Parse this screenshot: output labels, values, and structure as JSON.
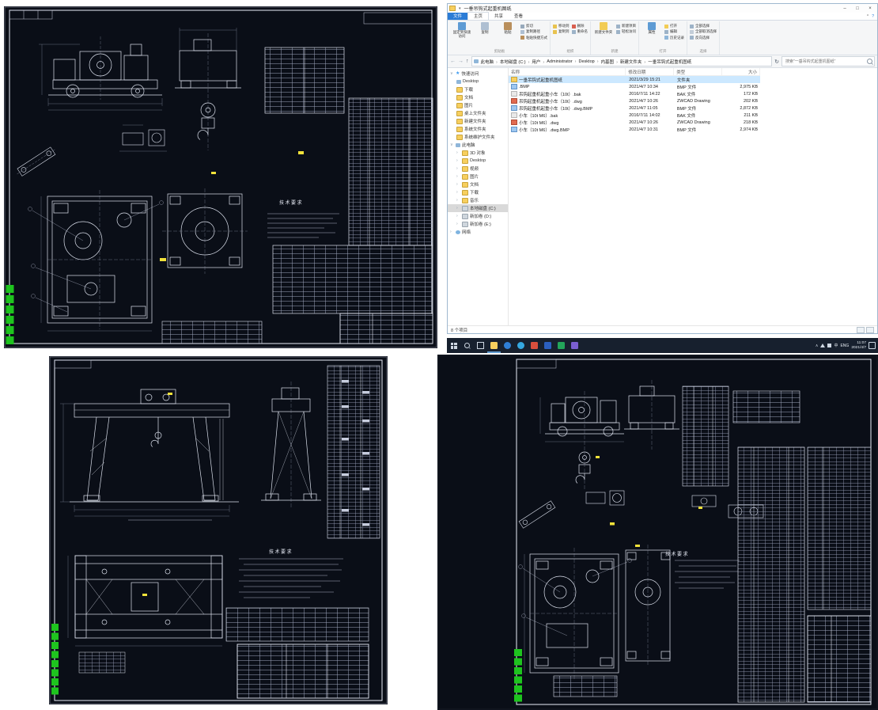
{
  "explorer": {
    "title": "一垂吊钩式起重机图纸",
    "tabs": {
      "file": "文件",
      "home": "主页",
      "share": "共享",
      "view": "查看"
    },
    "ribbon": {
      "pin_to_quick_access": "固定到快速访问",
      "copy": "复制",
      "paste": "粘贴",
      "cut": "剪切",
      "copy_path": "复制路径",
      "paste_shortcut": "粘贴快捷方式",
      "move_to": "移动到",
      "copy_to": "复制到",
      "delete": "删除",
      "rename": "重命名",
      "new_folder": "新建文件夹",
      "new_item": "新建项目",
      "easy_access": "轻松访问",
      "properties": "属性",
      "open": "打开",
      "edit": "编辑",
      "history": "历史记录",
      "select_all": "全部选择",
      "select_none": "全部取消选择",
      "invert": "反向选择",
      "group_clipboard": "剪贴板",
      "group_organize": "组织",
      "group_new": "新建",
      "group_open": "打开",
      "group_select": "选择"
    },
    "address": {
      "crumbs": [
        "此电脑",
        "本地磁盘 (C:)",
        "用户",
        "Administrator",
        "Desktop",
        "内基图",
        "新建文件夹",
        "一垂吊钩式起重机图纸"
      ],
      "search_placeholder": "搜索“一垂吊钩式起重机图纸”"
    },
    "columns": {
      "name": "名称",
      "date": "修改日期",
      "type": "类型",
      "size": "大小"
    },
    "files": [
      {
        "name": "一垂吊钩式起重机图纸",
        "date": "2021/3/29 15:21",
        "type": "文件夹",
        "size": ""
      },
      {
        "name": ".BMP",
        "date": "2021/4/7 10:34",
        "type": "BMP 文件",
        "size": "2,975 KB"
      },
      {
        "name": "吊钩起重机起重小车（10t）.bak",
        "date": "2016/7/11 14:22",
        "type": "BAK 文件",
        "size": "172 KB"
      },
      {
        "name": "吊钩起重机起重小车（10t）.dwg",
        "date": "2021/4/7 10:26",
        "type": "ZWCAD Drawing",
        "size": "202 KB"
      },
      {
        "name": "吊钩起重机起重小车（10t）.dwg.BMP",
        "date": "2021/4/7 11:05",
        "type": "BMP 文件",
        "size": "2,872 KB"
      },
      {
        "name": "小车（10t M6）.bak",
        "date": "2016/7/11 14:02",
        "type": "BAK 文件",
        "size": "211 KB"
      },
      {
        "name": "小车（10t M6）.dwg",
        "date": "2021/4/7 10:26",
        "type": "ZWCAD Drawing",
        "size": "218 KB"
      },
      {
        "name": "小车（10t M6）.dwg.BMP",
        "date": "2021/4/7 10:31",
        "type": "BMP 文件",
        "size": "2,974 KB"
      }
    ],
    "sidebar": {
      "quick_access": "快速访问",
      "quick_items": [
        "Desktop",
        "下载",
        "文档",
        "图片",
        "桌上文件夹",
        "新建文件夹",
        "系统文件夹",
        "系统维护文件夹"
      ],
      "this_pc": "此电脑",
      "pc_items": [
        "3D 对象",
        "Desktop",
        "视频",
        "图片",
        "文档",
        "下载",
        "音乐",
        "本地磁盘 (C:)",
        "新加卷 (D:)",
        "新加卷 (E:)"
      ],
      "network": "网络"
    },
    "status": "8 个项目"
  },
  "taskbar": {
    "ime": "中",
    "lang": "ENG",
    "time": "11:07",
    "date": "2021/4/7"
  },
  "cad": {
    "sheet1": {
      "notes_title": "技术要求"
    },
    "sheet2": {
      "notes_title": "技术要求"
    },
    "sheet3": {
      "notes_title": "技术要求"
    }
  }
}
